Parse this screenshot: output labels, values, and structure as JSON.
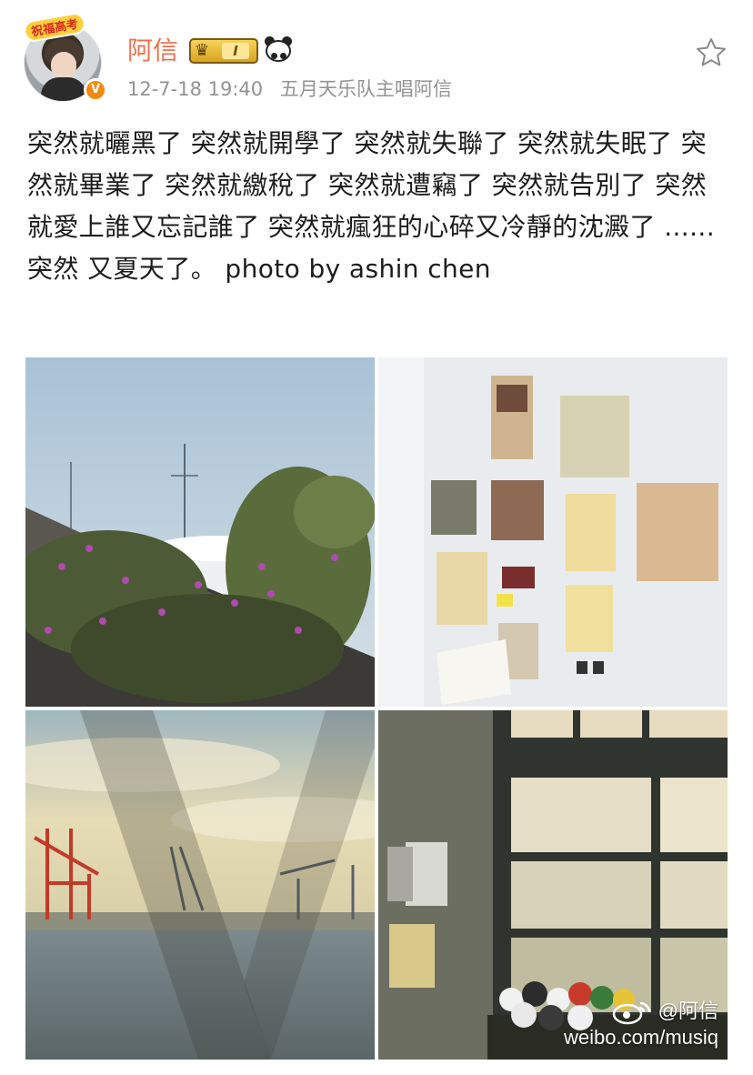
{
  "header": {
    "avatar_frame_text": "祝福高考",
    "verified_mark": "V",
    "username": "阿信",
    "member_level": "I",
    "timestamp": "12-7-18 19:40",
    "source": "五月天乐队主唱阿信"
  },
  "post": {
    "text": "突然就曬黑了 突然就開學了 突然就失聯了 突然就失眠了 突然就畢業了 突然就繳稅了 突然就遭竊了 突然就告別了 突然就愛上誰又忘記誰了 突然就瘋狂的心碎又冷靜的沈澱了 ...... 突然 又夏天了。 photo by ashin chen"
  },
  "watermark": {
    "user": "@阿信",
    "url": "weibo.com/musiq"
  },
  "colors": {
    "username": "#eb7350",
    "meta": "#939393",
    "verified": "#f28a0e"
  },
  "icons": [
    "crown-icon",
    "panda-icon",
    "star-icon",
    "verified-icon",
    "weibo-logo-icon"
  ]
}
